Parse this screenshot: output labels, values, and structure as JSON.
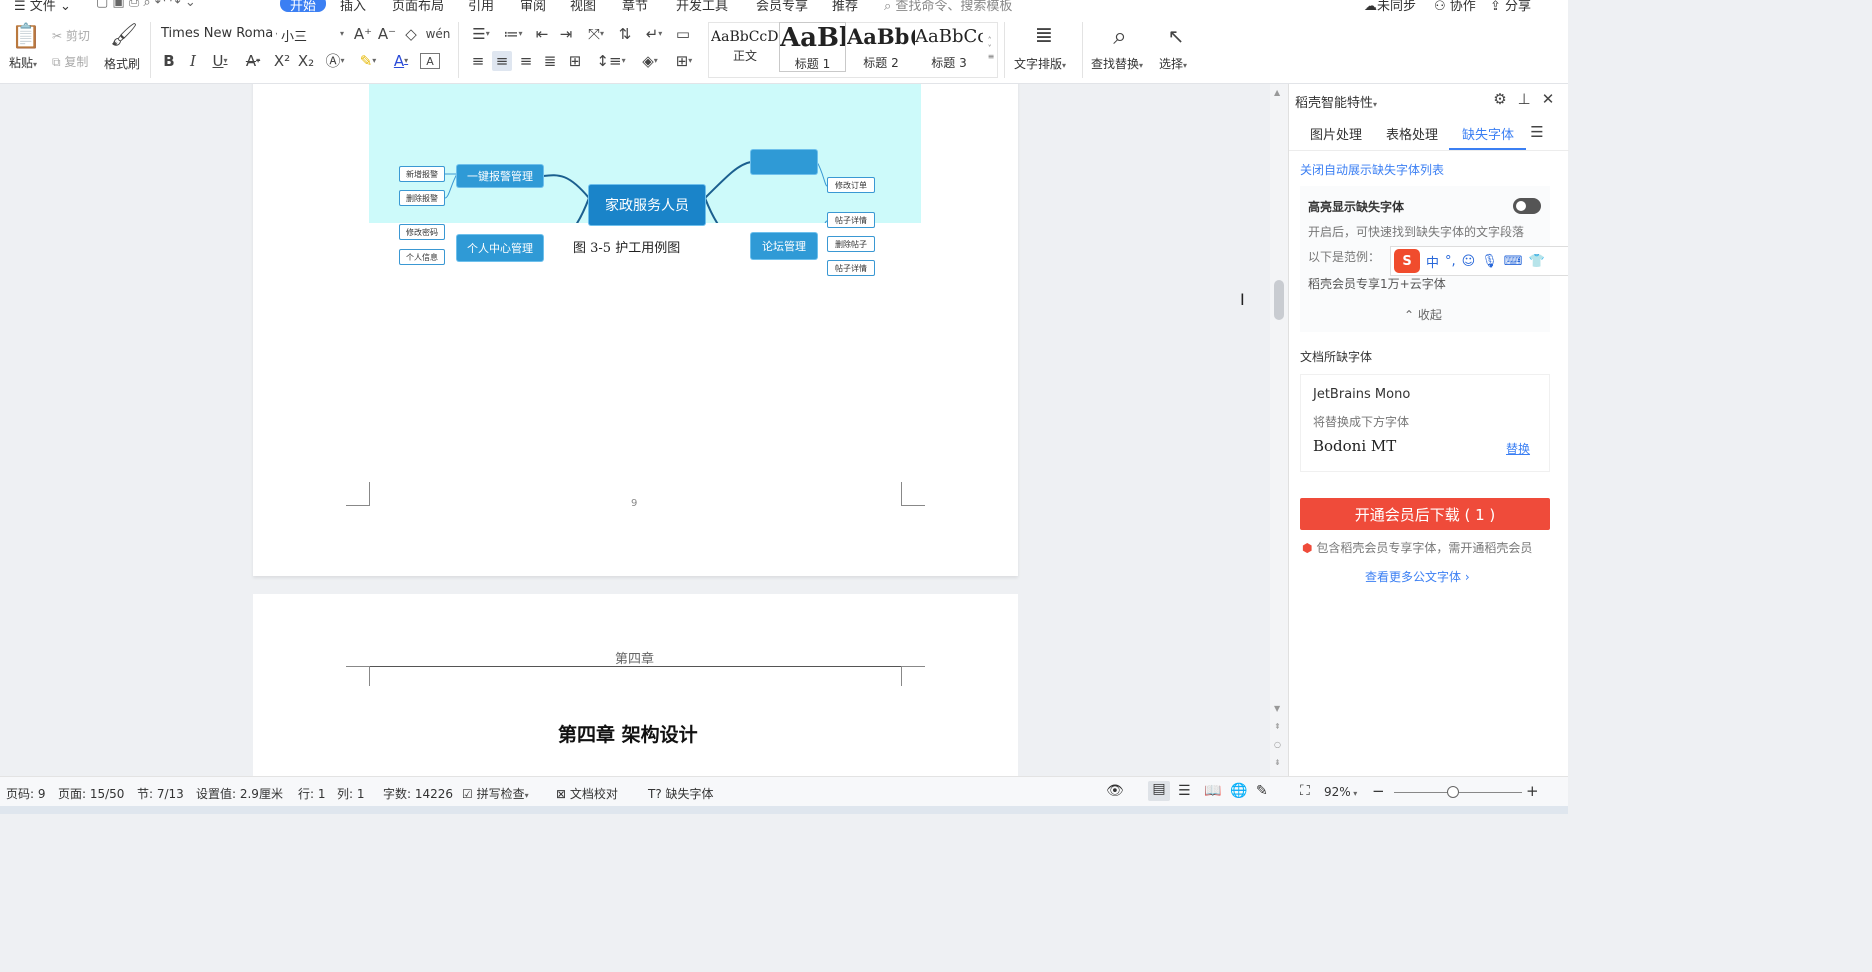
{
  "menu": {
    "file": "文件",
    "tabs": [
      "开始",
      "插入",
      "页面布局",
      "引用",
      "审阅",
      "视图",
      "章节",
      "开发工具",
      "会员专享",
      "推荐"
    ],
    "search_placeholder": "查找命令、搜索模板",
    "sync": "未同步",
    "collab": "协作",
    "share": "分享"
  },
  "ribbon": {
    "paste": "粘贴",
    "cut": "剪切",
    "copy": "复制",
    "format_painter": "格式刷",
    "font_name": "Times New Roma",
    "font_size": "小三",
    "styles": [
      {
        "sample": "AaBbCcDd",
        "label": "正文"
      },
      {
        "sample": "AaBl",
        "label": "标题 1"
      },
      {
        "sample": "AaBb(",
        "label": "标题 2"
      },
      {
        "sample": "AaBbCc",
        "label": "标题 3"
      }
    ],
    "text_layout": "文字排版",
    "find_replace": "查找替换",
    "select": "选择"
  },
  "document": {
    "mindmap": {
      "center": "家政服务人员",
      "nodes": [
        "一键报警管理",
        "个人中心管理",
        "论坛管理"
      ],
      "leaves_left": [
        "新增报警",
        "删除报警",
        "修改密码",
        "个人信息"
      ],
      "leaves_right": [
        "修改订单",
        "帖子详情",
        "删除帖子",
        "帖子详情"
      ]
    },
    "caption": "图 3-5 护工用例图",
    "page_number": "9",
    "header_text": "第四章",
    "chapter_title": "第四章  架构设计"
  },
  "panel": {
    "title": "稻壳智能特性",
    "tabs": [
      "图片处理",
      "表格处理",
      "缺失字体"
    ],
    "close_auto": "关闭自动展示缺失字体列表",
    "highlight_title": "高亮显示缺失字体",
    "highlight_desc": "开启后，可快速找到缺失字体的文字段落",
    "example_label": "以下是范例：",
    "example_text": "稻壳会员专享1万+云字体",
    "collapse": "收起",
    "missing_title": "文档所缺字体",
    "missing_font": "JetBrains Mono",
    "replace_hint": "将替换成下方字体",
    "replacement_font": "Bodoni MT",
    "replace_btn": "替换",
    "download_btn": "开通会员后下载 ( 1 )",
    "member_note": "包含稻壳会员专享字体，需开通稻壳会员",
    "more_fonts": "查看更多公文字体"
  },
  "statusbar": {
    "page_code": "页码: 9",
    "page": "页面: 15/50",
    "section": "节: 7/13",
    "setting": "设置值: 2.9厘米",
    "row": "行: 1",
    "col": "列: 1",
    "words": "字数: 14226",
    "spell": "拼写检查",
    "proof": "文档校对",
    "missing": "缺失字体",
    "zoom": "92%",
    "zoom_level": 0.46
  },
  "colors": {
    "accent": "#3b7ff3",
    "cta": "#ef4b3a",
    "mindmap_bg": "#cdfafa",
    "node": "#2f9ad6"
  }
}
